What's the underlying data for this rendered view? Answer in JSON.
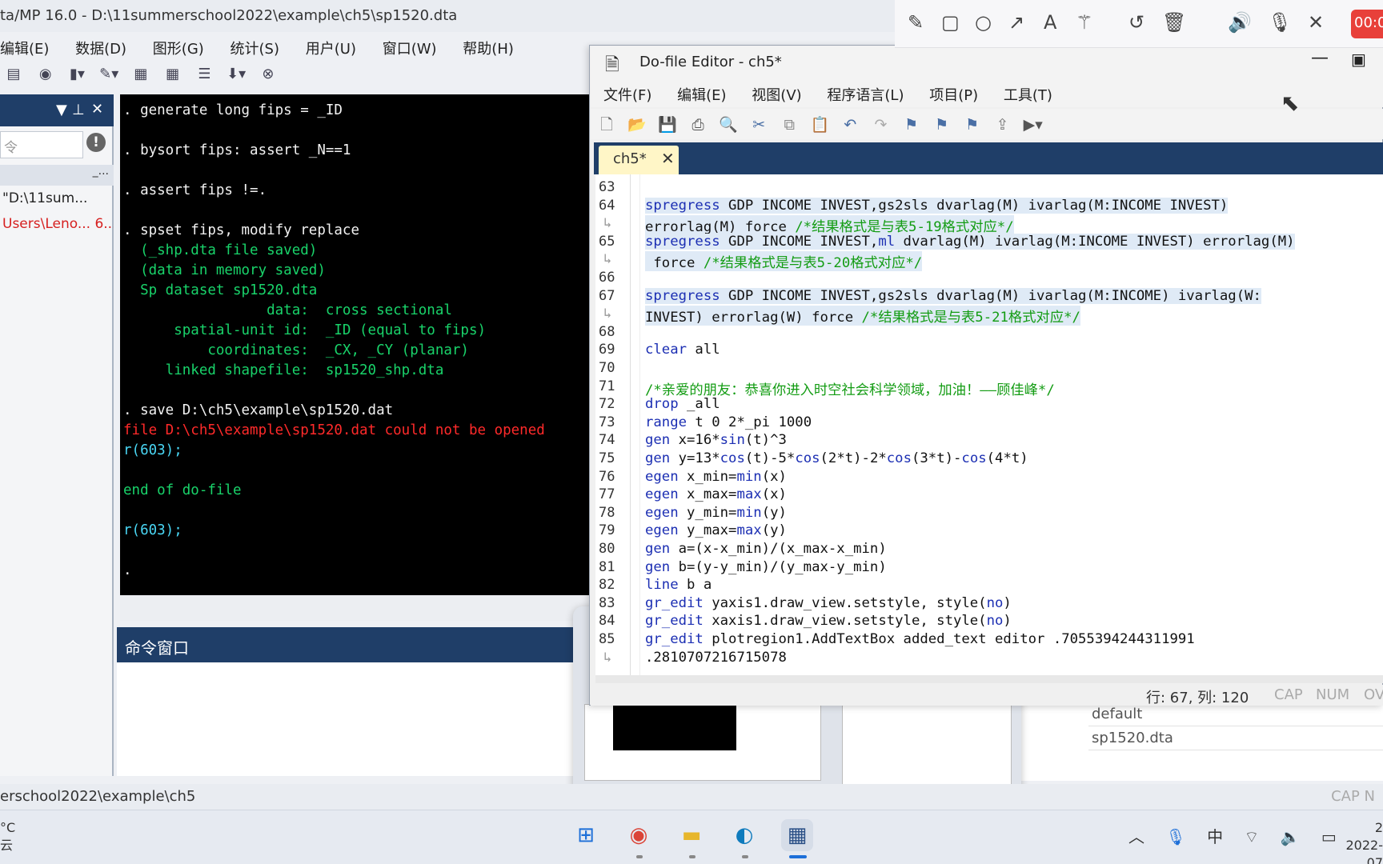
{
  "stata": {
    "title": "ta/MP 16.0 - D:\\11summerschool2022\\example\\ch5\\sp1520.dta",
    "menu": [
      "编辑(E)",
      "数据(D)",
      "图形(G)",
      "统计(S)",
      "用户(U)",
      "窗口(W)",
      "帮助(H)"
    ],
    "left_filter_placeholder": "令",
    "left_colhead": "_...",
    "history": [
      {
        "text": "\"D:\\11sum...",
        "color": "#222222"
      },
      {
        "text": "Users\\Leno...  6...",
        "color": "#d62020"
      }
    ],
    "results": [
      {
        "text": ". generate long fips = _ID",
        "cls": "r-white"
      },
      {
        "text": "",
        "cls": "r-white"
      },
      {
        "text": ". bysort fips: assert _N==1",
        "cls": "r-white"
      },
      {
        "text": "",
        "cls": "r-white"
      },
      {
        "text": ". assert fips !=.",
        "cls": "r-white"
      },
      {
        "text": "",
        "cls": "r-white"
      },
      {
        "text": ". spset fips, modify replace",
        "cls": "r-white"
      },
      {
        "text": "  (_shp.dta file saved)",
        "cls": "r-green"
      },
      {
        "text": "  (data in memory saved)",
        "cls": "r-green"
      },
      {
        "text": "  Sp dataset sp1520.dta",
        "cls": "r-green"
      },
      {
        "text": "                 data:  cross sectional",
        "cls": "r-green"
      },
      {
        "text": "      spatial-unit id:  _ID (equal to fips)",
        "cls": "r-green"
      },
      {
        "text": "          coordinates:  _CX, _CY (planar)",
        "cls": "r-green"
      },
      {
        "text": "     linked shapefile:  sp1520_shp.dta",
        "cls": "r-green"
      },
      {
        "text": "",
        "cls": "r-white"
      },
      {
        "text": ". save D:\\ch5\\example\\sp1520.dat",
        "cls": "r-white"
      },
      {
        "text": "file D:\\ch5\\example\\sp1520.dat could not be opened",
        "cls": "r-red"
      },
      {
        "text": "r(603);",
        "cls": "r-cyan"
      },
      {
        "text": "",
        "cls": "r-white"
      },
      {
        "text": "end of do-file",
        "cls": "r-green"
      },
      {
        "text": "",
        "cls": "r-white"
      },
      {
        "text": "r(603);",
        "cls": "r-cyan"
      },
      {
        "text": "",
        "cls": "r-white"
      },
      {
        "text": ".",
        "cls": "r-white"
      }
    ],
    "command_window_title": "命令窗口",
    "status_path": "erschool2022\\example\\ch5",
    "status_right": "CAP  N",
    "properties": [
      "default",
      "sp1520.dta"
    ]
  },
  "editor": {
    "title": "Do-file Editor - ch5*",
    "menu": [
      "文件(F)",
      "编辑(E)",
      "视图(V)",
      "程序语言(L)",
      "项目(P)",
      "工具(T)"
    ],
    "tab": "ch5*",
    "status": "行: 67, 列: 120",
    "status_flags": [
      "CAP",
      "NUM",
      "OV"
    ],
    "lines": [
      {
        "n": "63",
        "html": "",
        "bg": "hl"
      },
      {
        "n": "64",
        "html": "<span class='kw'>spregress</span> GDP INCOME INVEST,gs2sls dvarlag(M) ivarlag(M:INCOME INVEST)",
        "bg": "hl"
      },
      {
        "n": "↳",
        "html": "errorlag(M) force <span class='cm'>/*结果格式是与表5-19格式对应*/</span>",
        "bg": "hl"
      },
      {
        "n": "65",
        "html": "<span class='kw'>spregress</span> GDP INCOME INVEST,<span class='kw'>ml</span> dvarlag(M) ivarlag(M:INCOME INVEST) errorlag(M)",
        "bg": "hl"
      },
      {
        "n": "↳",
        "html": " force <span class='cm'>/*结果格式是与表5-20格式对应*/</span>",
        "bg": "hl"
      },
      {
        "n": "66",
        "html": "",
        "bg": "hl"
      },
      {
        "n": "67",
        "html": "<span class='kw'>spregress</span> GDP INCOME INVEST,gs2sls dvarlag(M) ivarlag(M:INCOME) ivarlag(W:",
        "bg": "hl"
      },
      {
        "n": "↳",
        "html": "INVEST) errorlag(W) force <span class='cm'>/*结果格式是与表5-21格式对应*/</span>",
        "bg": "hl"
      },
      {
        "n": "68",
        "html": "",
        "bg": ""
      },
      {
        "n": "69",
        "html": "<span class='kw'>clear</span> all",
        "bg": ""
      },
      {
        "n": "70",
        "html": "",
        "bg": ""
      },
      {
        "n": "71",
        "html": "<span class='cm'>/*亲爱的朋友：恭喜你进入时空社会科学领域，加油！——顾佳峰*/</span>",
        "bg": ""
      },
      {
        "n": "72",
        "html": "<span class='kw'>drop</span> _all",
        "bg": ""
      },
      {
        "n": "73",
        "html": "<span class='kw'>range</span> t 0 2*_pi 1000",
        "bg": ""
      },
      {
        "n": "74",
        "html": "<span class='kw'>gen</span> x=16*<span class='fn'>sin</span>(t)^3",
        "bg": ""
      },
      {
        "n": "75",
        "html": "<span class='kw'>gen</span> y=13*<span class='fn'>cos</span>(t)-5*<span class='fn'>cos</span>(2*t)-2*<span class='fn'>cos</span>(3*t)-<span class='fn'>cos</span>(4*t)",
        "bg": ""
      },
      {
        "n": "76",
        "html": "<span class='kw'>egen</span> x_min=<span class='fn'>min</span>(x)",
        "bg": ""
      },
      {
        "n": "77",
        "html": "<span class='kw'>egen</span> x_max=<span class='fn'>max</span>(x)",
        "bg": ""
      },
      {
        "n": "78",
        "html": "<span class='kw'>egen</span> y_min=<span class='fn'>min</span>(y)",
        "bg": ""
      },
      {
        "n": "79",
        "html": "<span class='kw'>egen</span> y_max=<span class='fn'>max</span>(y)",
        "bg": ""
      },
      {
        "n": "80",
        "html": "<span class='kw'>gen</span> a=(x-x_min)/(x_max-x_min)",
        "bg": ""
      },
      {
        "n": "81",
        "html": "<span class='kw'>gen</span> b=(y-y_min)/(y_max-y_min)",
        "bg": ""
      },
      {
        "n": "82",
        "html": "<span class='kw'>line</span> b a",
        "bg": ""
      },
      {
        "n": "83",
        "html": "<span class='kw'>gr_edit</span> yaxis1.draw_view.setstyle, style(<span class='kw'>no</span>)",
        "bg": ""
      },
      {
        "n": "84",
        "html": "<span class='kw'>gr_edit</span> xaxis1.draw_view.setstyle, style(<span class='kw'>no</span>)",
        "bg": ""
      },
      {
        "n": "85",
        "html": "<span class='kw'>gr_edit</span> plotregion1.AddTextBox added_text editor .7055394244311991",
        "bg": ""
      },
      {
        "n": "↳",
        "html": ".2810707216715078",
        "bg": ""
      }
    ]
  },
  "recorder": {
    "timer": "00:0"
  },
  "taskbar": {
    "weather_temp": "°C",
    "weather_desc": "云",
    "ime": "中",
    "time": "2",
    "date": "2022-07"
  },
  "colors": {
    "accent_dark": "#1f3e68",
    "tab_yellow": "#fff6c7",
    "record_red": "#e8403a"
  }
}
